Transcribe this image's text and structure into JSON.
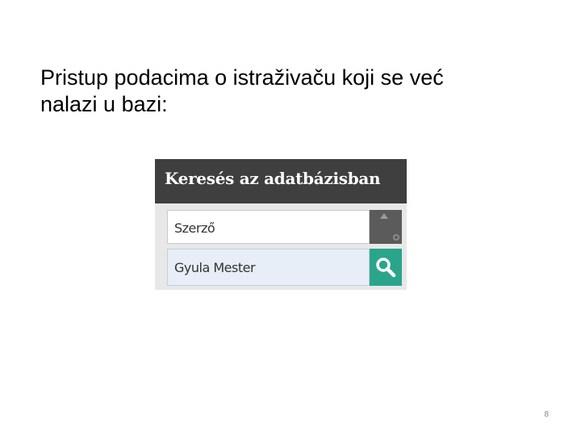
{
  "slide": {
    "text_line1": "Pristup podacima o istraživaču koji se već",
    "text_line2": "nalazi u bazi:",
    "page_number": "8"
  },
  "widget": {
    "title": "Keresés az adatbázisban",
    "field_select": {
      "value": "Szerző"
    },
    "search_input": {
      "value": "Gyula Mester"
    },
    "icons": {
      "scroll_up": "triangle-up-icon",
      "scroll_knob": "circle-icon",
      "search": "magnifier-icon"
    },
    "colors": {
      "header": "#3f3f3f",
      "search_button": "#2aa58c",
      "input_background": "#e7eef8"
    }
  }
}
